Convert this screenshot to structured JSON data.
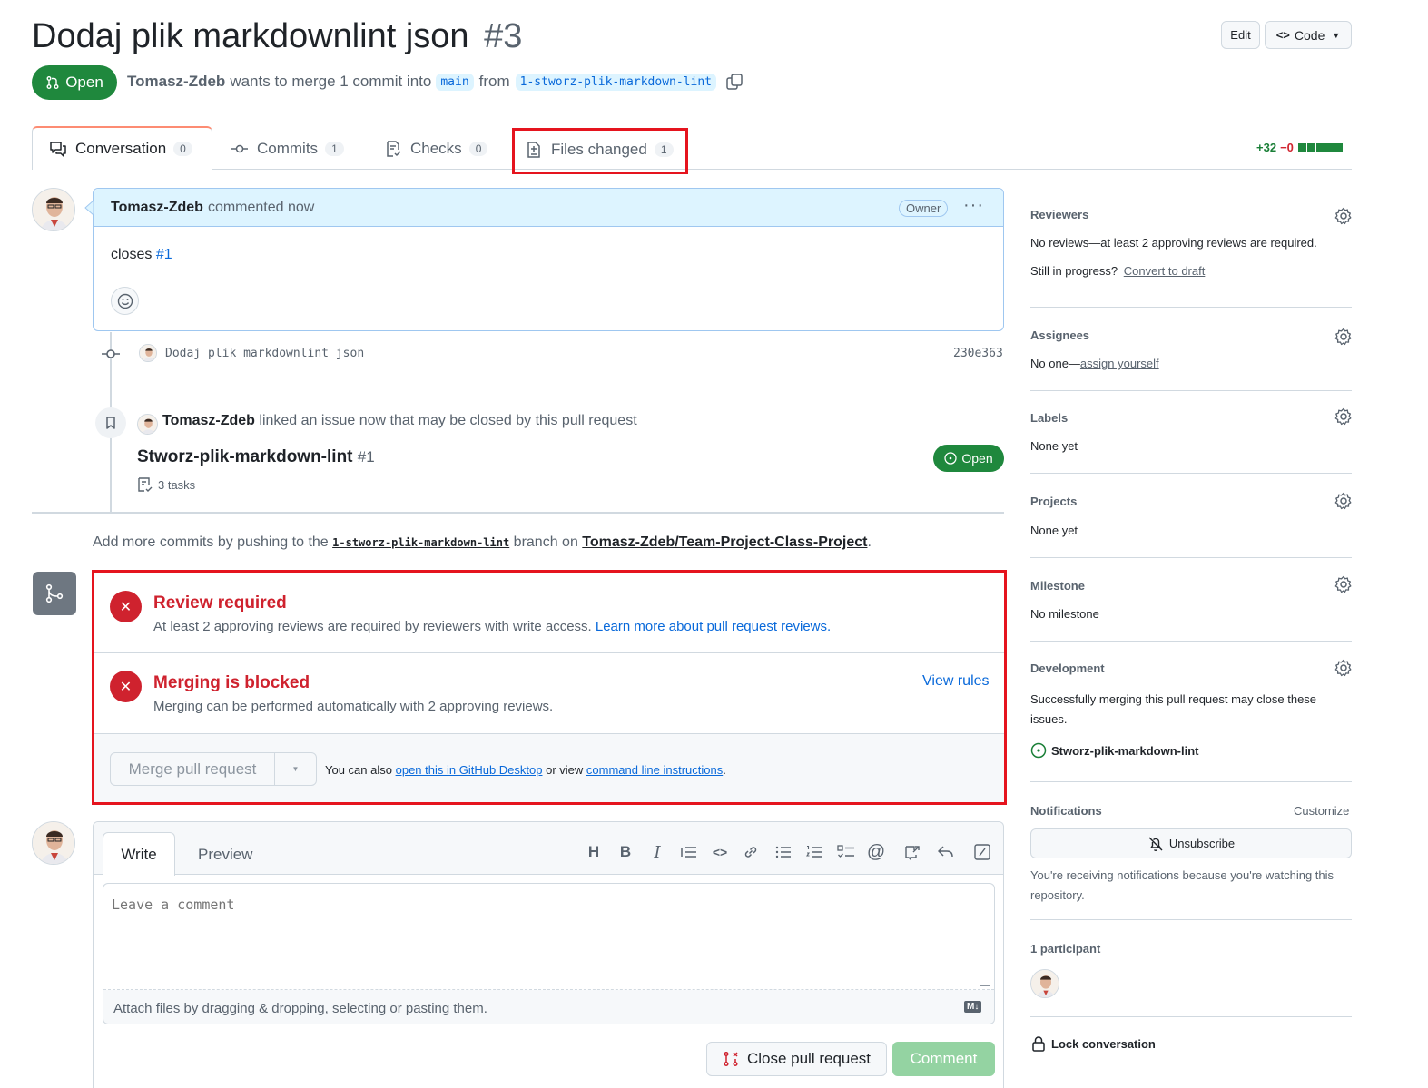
{
  "pr": {
    "title": "Dodaj plik markdownlint json",
    "number": "#3",
    "state": "Open",
    "author": "Tomasz-Zdeb",
    "merge_text": "wants to merge 1 commit into",
    "base_branch": "main",
    "from_text": "from",
    "head_branch": "1-stworz-plik-markdown-lint"
  },
  "header_buttons": {
    "edit": "Edit",
    "code": "Code"
  },
  "tabs": [
    {
      "label": "Conversation",
      "count": "0"
    },
    {
      "label": "Commits",
      "count": "1"
    },
    {
      "label": "Checks",
      "count": "0"
    },
    {
      "label": "Files changed",
      "count": "1"
    }
  ],
  "diffstat": {
    "added": "+32",
    "removed": "−0"
  },
  "comment": {
    "author": "Tomasz-Zdeb",
    "time": "commented now",
    "badge": "Owner",
    "body_text": "closes",
    "body_link": "#1"
  },
  "commit": {
    "message": "Dodaj plik markdownlint json",
    "sha": "230e363"
  },
  "linked_event": {
    "author": "Tomasz-Zdeb",
    "text1": "linked an issue",
    "when": "now",
    "text2": "that may be closed by this pull request",
    "issue_title": "Stworz-plik-markdown-lint",
    "issue_number": "#1",
    "tasks": "3 tasks",
    "state": "Open"
  },
  "push_hint": {
    "prefix": "Add more commits by pushing to the",
    "branch": "1-stworz-plik-markdown-lint",
    "middle": "branch on",
    "repo": "Tomasz-Zdeb/Team-Project-Class-Project",
    "suffix": "."
  },
  "merge_box": {
    "review_title": "Review required",
    "review_text": "At least 2 approving reviews are required by reviewers with write access.",
    "review_link": "Learn more about pull request reviews.",
    "blocked_title": "Merging is blocked",
    "blocked_text": "Merging can be performed automatically with 2 approving reviews.",
    "view_rules": "View rules",
    "merge_button": "Merge pull request",
    "also_text": "You can also",
    "desktop_link": "open this in GitHub Desktop",
    "or_view": "or view",
    "cli_link": "command line instructions",
    "period": "."
  },
  "composer": {
    "tab_write": "Write",
    "tab_preview": "Preview",
    "placeholder": "Leave a comment",
    "attach_text": "Attach files by dragging & dropping, selecting or pasting them.",
    "md_badge": "M↓",
    "close_button": "Close pull request",
    "comment_button": "Comment"
  },
  "sidebar": {
    "reviewers": {
      "title": "Reviewers",
      "text": "No reviews—at least 2 approving reviews are required.",
      "progress": "Still in progress?",
      "draft_link": "Convert to draft"
    },
    "assignees": {
      "title": "Assignees",
      "text": "No one—",
      "link": "assign yourself"
    },
    "labels": {
      "title": "Labels",
      "text": "None yet"
    },
    "projects": {
      "title": "Projects",
      "text": "None yet"
    },
    "milestone": {
      "title": "Milestone",
      "text": "No milestone"
    },
    "development": {
      "title": "Development",
      "text": "Successfully merging this pull request may close these issues.",
      "issue": "Stworz-plik-markdown-lint"
    },
    "notifications": {
      "title": "Notifications",
      "customize": "Customize",
      "button": "Unsubscribe",
      "text": "You're receiving notifications because you're watching this repository."
    },
    "participants": {
      "title": "1 participant"
    },
    "lock": {
      "label": "Lock conversation"
    }
  },
  "colors": {
    "open_green": "#1f883d",
    "danger_red": "#cf222e",
    "accent_blue": "#0969da",
    "highlight_red": "#e5141e"
  }
}
